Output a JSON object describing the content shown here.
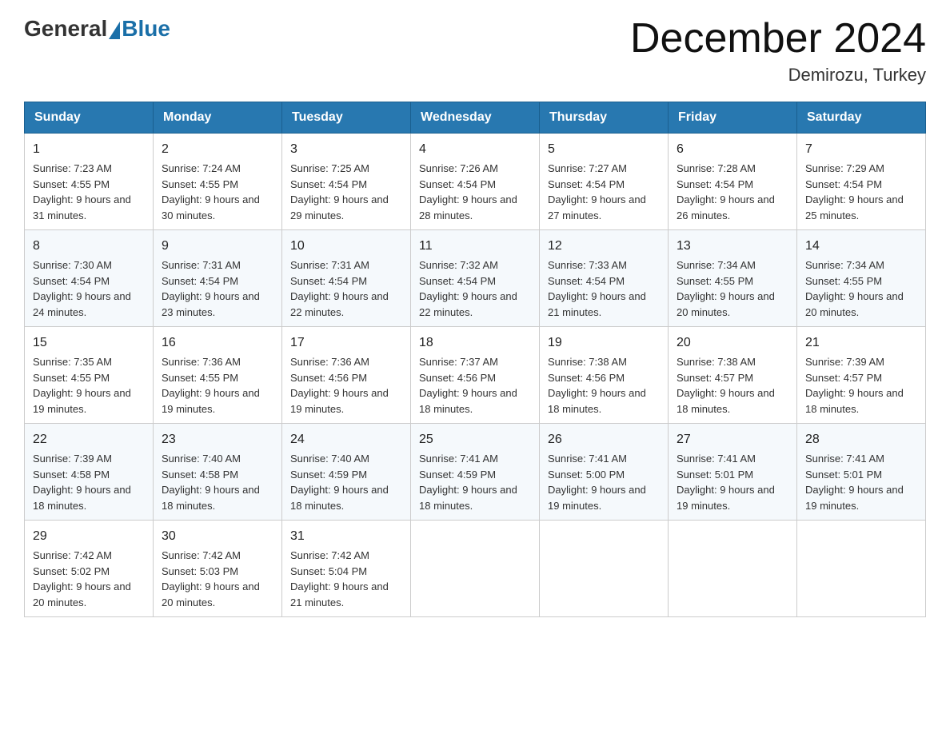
{
  "header": {
    "logo": {
      "general": "General",
      "blue": "Blue",
      "tagline": ""
    },
    "title": "December 2024",
    "location": "Demirozu, Turkey"
  },
  "days_of_week": [
    "Sunday",
    "Monday",
    "Tuesday",
    "Wednesday",
    "Thursday",
    "Friday",
    "Saturday"
  ],
  "weeks": [
    [
      {
        "day": "1",
        "sunrise": "7:23 AM",
        "sunset": "4:55 PM",
        "daylight": "9 hours and 31 minutes."
      },
      {
        "day": "2",
        "sunrise": "7:24 AM",
        "sunset": "4:55 PM",
        "daylight": "9 hours and 30 minutes."
      },
      {
        "day": "3",
        "sunrise": "7:25 AM",
        "sunset": "4:54 PM",
        "daylight": "9 hours and 29 minutes."
      },
      {
        "day": "4",
        "sunrise": "7:26 AM",
        "sunset": "4:54 PM",
        "daylight": "9 hours and 28 minutes."
      },
      {
        "day": "5",
        "sunrise": "7:27 AM",
        "sunset": "4:54 PM",
        "daylight": "9 hours and 27 minutes."
      },
      {
        "day": "6",
        "sunrise": "7:28 AM",
        "sunset": "4:54 PM",
        "daylight": "9 hours and 26 minutes."
      },
      {
        "day": "7",
        "sunrise": "7:29 AM",
        "sunset": "4:54 PM",
        "daylight": "9 hours and 25 minutes."
      }
    ],
    [
      {
        "day": "8",
        "sunrise": "7:30 AM",
        "sunset": "4:54 PM",
        "daylight": "9 hours and 24 minutes."
      },
      {
        "day": "9",
        "sunrise": "7:31 AM",
        "sunset": "4:54 PM",
        "daylight": "9 hours and 23 minutes."
      },
      {
        "day": "10",
        "sunrise": "7:31 AM",
        "sunset": "4:54 PM",
        "daylight": "9 hours and 22 minutes."
      },
      {
        "day": "11",
        "sunrise": "7:32 AM",
        "sunset": "4:54 PM",
        "daylight": "9 hours and 22 minutes."
      },
      {
        "day": "12",
        "sunrise": "7:33 AM",
        "sunset": "4:54 PM",
        "daylight": "9 hours and 21 minutes."
      },
      {
        "day": "13",
        "sunrise": "7:34 AM",
        "sunset": "4:55 PM",
        "daylight": "9 hours and 20 minutes."
      },
      {
        "day": "14",
        "sunrise": "7:34 AM",
        "sunset": "4:55 PM",
        "daylight": "9 hours and 20 minutes."
      }
    ],
    [
      {
        "day": "15",
        "sunrise": "7:35 AM",
        "sunset": "4:55 PM",
        "daylight": "9 hours and 19 minutes."
      },
      {
        "day": "16",
        "sunrise": "7:36 AM",
        "sunset": "4:55 PM",
        "daylight": "9 hours and 19 minutes."
      },
      {
        "day": "17",
        "sunrise": "7:36 AM",
        "sunset": "4:56 PM",
        "daylight": "9 hours and 19 minutes."
      },
      {
        "day": "18",
        "sunrise": "7:37 AM",
        "sunset": "4:56 PM",
        "daylight": "9 hours and 18 minutes."
      },
      {
        "day": "19",
        "sunrise": "7:38 AM",
        "sunset": "4:56 PM",
        "daylight": "9 hours and 18 minutes."
      },
      {
        "day": "20",
        "sunrise": "7:38 AM",
        "sunset": "4:57 PM",
        "daylight": "9 hours and 18 minutes."
      },
      {
        "day": "21",
        "sunrise": "7:39 AM",
        "sunset": "4:57 PM",
        "daylight": "9 hours and 18 minutes."
      }
    ],
    [
      {
        "day": "22",
        "sunrise": "7:39 AM",
        "sunset": "4:58 PM",
        "daylight": "9 hours and 18 minutes."
      },
      {
        "day": "23",
        "sunrise": "7:40 AM",
        "sunset": "4:58 PM",
        "daylight": "9 hours and 18 minutes."
      },
      {
        "day": "24",
        "sunrise": "7:40 AM",
        "sunset": "4:59 PM",
        "daylight": "9 hours and 18 minutes."
      },
      {
        "day": "25",
        "sunrise": "7:41 AM",
        "sunset": "4:59 PM",
        "daylight": "9 hours and 18 minutes."
      },
      {
        "day": "26",
        "sunrise": "7:41 AM",
        "sunset": "5:00 PM",
        "daylight": "9 hours and 19 minutes."
      },
      {
        "day": "27",
        "sunrise": "7:41 AM",
        "sunset": "5:01 PM",
        "daylight": "9 hours and 19 minutes."
      },
      {
        "day": "28",
        "sunrise": "7:41 AM",
        "sunset": "5:01 PM",
        "daylight": "9 hours and 19 minutes."
      }
    ],
    [
      {
        "day": "29",
        "sunrise": "7:42 AM",
        "sunset": "5:02 PM",
        "daylight": "9 hours and 20 minutes."
      },
      {
        "day": "30",
        "sunrise": "7:42 AM",
        "sunset": "5:03 PM",
        "daylight": "9 hours and 20 minutes."
      },
      {
        "day": "31",
        "sunrise": "7:42 AM",
        "sunset": "5:04 PM",
        "daylight": "9 hours and 21 minutes."
      },
      null,
      null,
      null,
      null
    ]
  ],
  "labels": {
    "sunrise_prefix": "Sunrise: ",
    "sunset_prefix": "Sunset: ",
    "daylight_prefix": "Daylight: "
  }
}
